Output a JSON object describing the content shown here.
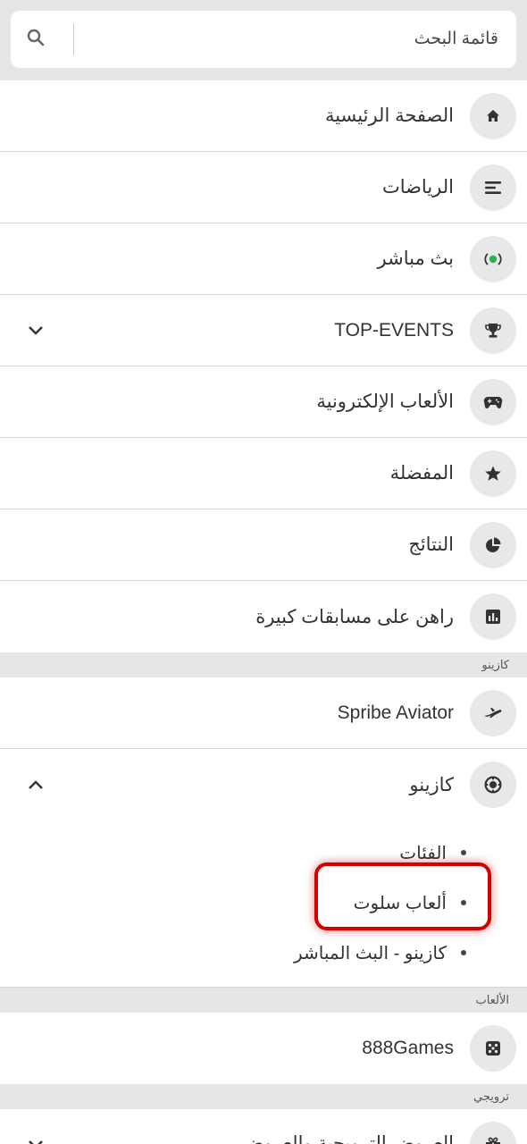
{
  "search": {
    "placeholder": "قائمة البحث"
  },
  "menu": [
    {
      "label": "الصفحة الرئيسية",
      "icon": "home-icon"
    },
    {
      "label": "الرياضات",
      "icon": "list-icon"
    },
    {
      "label": "بث مباشر",
      "icon": "live-icon"
    },
    {
      "label": "TOP-EVENTS",
      "icon": "trophy-icon",
      "expand": "chevron-down"
    },
    {
      "label": "الألعاب الإلكترونية",
      "icon": "gamepad-icon"
    },
    {
      "label": "المفضلة",
      "icon": "star-icon"
    },
    {
      "label": "النتائج",
      "icon": "pie-chart-icon"
    },
    {
      "label": "راهن على مسابقات كبيرة",
      "icon": "bar-chart-icon"
    }
  ],
  "sections": {
    "casino": "كازينو",
    "games": "الألعاب",
    "promo": "ترويجي"
  },
  "casino_items": [
    {
      "label": "Spribe Aviator",
      "icon": "airplane-icon"
    },
    {
      "label": "كازينو",
      "icon": "chip-icon",
      "expand": "chevron-up"
    }
  ],
  "casino_sub": [
    {
      "label": "الفئات"
    },
    {
      "label": "ألعاب سلوت",
      "highlighted": true
    },
    {
      "label": "كازينو - البث المباشر"
    }
  ],
  "games_items": [
    {
      "label": "888Games",
      "icon": "dice-icon"
    }
  ],
  "promo_items": [
    {
      "label": "العروض الترويجية والعروض",
      "icon": "gift-icon",
      "expand": "chevron-down"
    }
  ],
  "colors": {
    "live_dot": "#2bb24c",
    "highlight": "#d40000"
  }
}
